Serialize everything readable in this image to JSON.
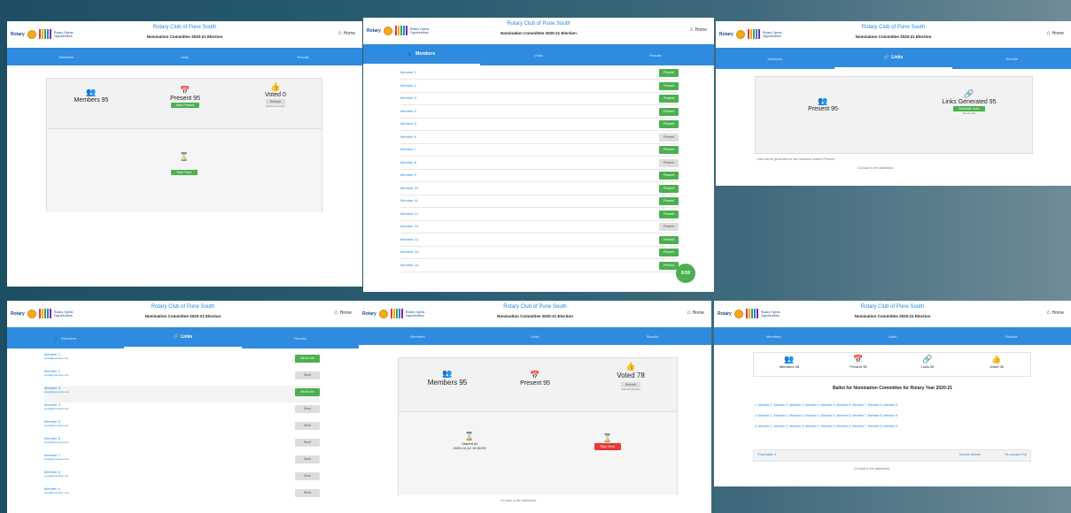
{
  "app": {
    "club_title": "Rotary Club of Pune South",
    "committee_title": "Nomination Committee 2020-21 Election",
    "rotary_text": "Rotary",
    "opportunities_text": "Rotary Opens Opportunities",
    "home_label": "Home"
  },
  "nav": {
    "members": "Members",
    "links": "Links",
    "results": "Results"
  },
  "dashboard1": {
    "members": "Members 95",
    "present": "Present 95",
    "present_btn": "Mark Present",
    "voted": "Voted 0",
    "voted_btn": "Refresh",
    "voted_sub": "Refresh Results",
    "start_btn": "Start Timer"
  },
  "members_list": {
    "names": [
      "Member 1",
      "Member 2",
      "Member 3",
      "Member 4",
      "Member 5",
      "Member 6",
      "Member 7",
      "Member 8",
      "Member 9",
      "Member 10",
      "Member 11",
      "Member 12",
      "Member 13",
      "Member 14",
      "Member 15",
      "Member 16"
    ],
    "present_label": "Present",
    "timer": "9:59"
  },
  "links_panel": {
    "present": "Present 95",
    "links": "Links Generated 95",
    "links_btn": "Generate Links",
    "links_sub": "Send Links",
    "note": "Links will be generated for the members marked Present",
    "footer": "Go back to the dashboard"
  },
  "links_list": {
    "members": [
      {
        "name": "Member 1",
        "email": "email@example.com",
        "state": "sent"
      },
      {
        "name": "Member 2",
        "email": "email@example.com",
        "state": "none"
      },
      {
        "name": "Member 3",
        "email": "email@example.com",
        "state": "sent"
      },
      {
        "name": "Member 4",
        "email": "email@example.com",
        "state": "none"
      },
      {
        "name": "Member 5",
        "email": "email@example.com",
        "state": "none"
      },
      {
        "name": "Member 6",
        "email": "email@example.com",
        "state": "none"
      },
      {
        "name": "Member 7",
        "email": "email@example.com",
        "state": "none"
      },
      {
        "name": "Member 8",
        "email": "email@example.com",
        "state": "none"
      },
      {
        "name": "Member 9",
        "email": "email@example.com",
        "state": "none"
      }
    ],
    "sent_label": "Send Link",
    "none_label": "Send"
  },
  "dashboard2": {
    "members": "Members 95",
    "present": "Present 95",
    "voted": "Voted 78",
    "voted_btn": "Refresh",
    "voted_sub": "Refresh Results",
    "started": "Started At",
    "started_time": "2020-12-12 10:30:00",
    "stop_btn": "Stop Timer",
    "footer": "Go back to the dashboard"
  },
  "results": {
    "members": "Members 95",
    "present": "Present 95",
    "links": "Links 95",
    "voted": "Voted 95",
    "heading": "Ballot for Nomination Committee for Rotary Year 2020-21",
    "lines": [
      "1. Member 1, Member 2, Member 3, Member 4, Member 5, Member 6, Member 7, Member 8, Member 9",
      "2. Member 1, Member 2, Member 3, Member 4, Member 5, Member 6, Member 7, Member 8, Member 9",
      "3. Member 1, Member 2, Member 3, Member 4, Member 5, Member 6, Member 7, Member 8, Member 9"
    ],
    "final_label": "Final Ballot: 3",
    "action1": "Declare Winner",
    "action2": "Re-conduct Poll",
    "footer": "Go back to the dashboard"
  }
}
